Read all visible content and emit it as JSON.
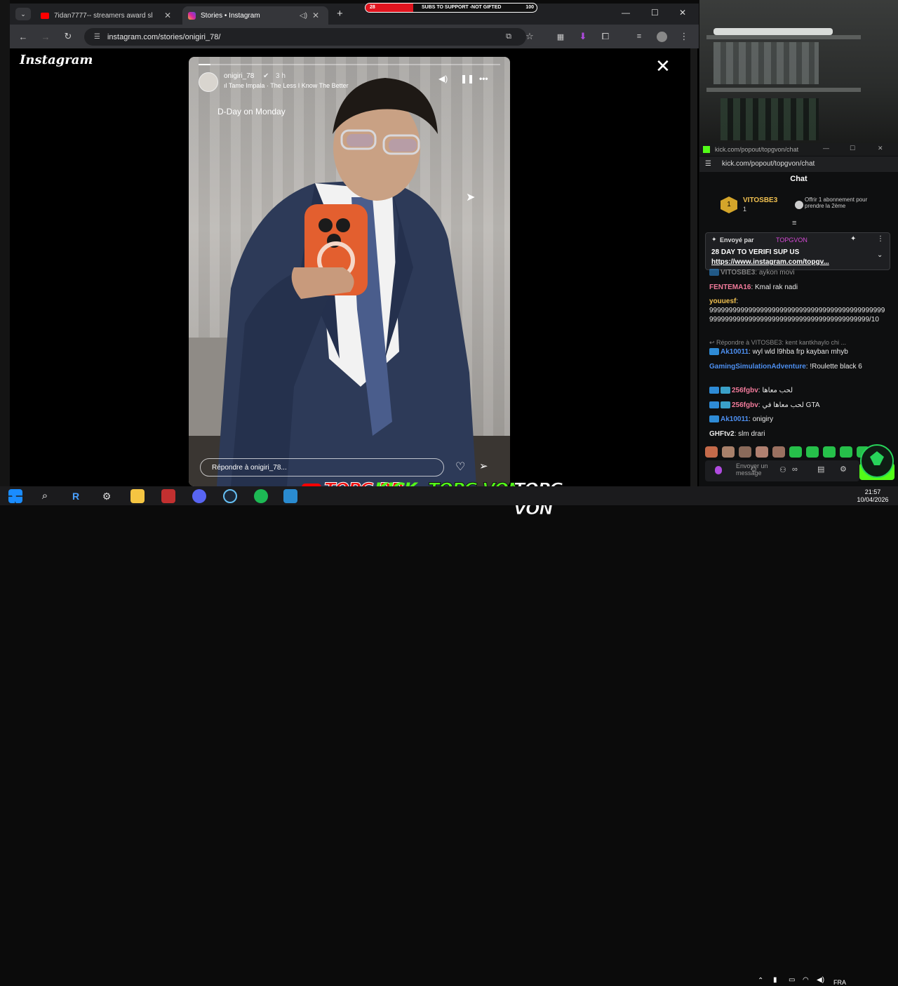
{
  "browser": {
    "tabs": [
      {
        "title": "7idan7777-- streamers award sl"
      },
      {
        "title": "Stories • Instagram"
      }
    ],
    "url": "instagram.com/stories/onigiri_78/"
  },
  "subs_bar": {
    "left": "28",
    "label": "SUBS TO SUPPORT -NOT GIFTED",
    "right": "100",
    "progress": 0.28
  },
  "instagram": {
    "logo": "Instagram",
    "story": {
      "username": "onigiri_78",
      "time": "3 h",
      "music": "Tame Impala · The Less I Know The Better",
      "caption": "D-Day on Monday",
      "reply_placeholder": "Répondre à onigiri_78...",
      "progress": 0.04
    }
  },
  "kick": {
    "window_title": "kick.com/popout/topgvon/chat",
    "url": "kick.com/popout/topgvon/chat",
    "chat_header": "Chat",
    "sub_card": {
      "user": "VITOSBE3",
      "count": "1",
      "offer": "Offrir 1 abonnement pour prendre la 2ème"
    },
    "pinned": {
      "sent_by": "Envoyé par",
      "sender": "TOPGVON",
      "text": "28 DAY TO VERIFI SUP US",
      "link": "https://www.instagram.com/topgv..."
    },
    "messages": [
      {
        "user": "VITOSBE3",
        "text": "aykon movi",
        "color": "#c9c9c9"
      },
      {
        "user": "FENTEMA16",
        "text": "Kmal rak nadi",
        "color": "#f07a9a"
      },
      {
        "user": "youuesf",
        "text": "99999999999999999999999999999999999999999999999999999999999999999999999999999999999999/10",
        "color": "#f0c050"
      },
      {
        "reply": "Répondre à VITOSBE3: kent kantkhaylo chi ..."
      },
      {
        "user": "Ak10011",
        "text": "wyl wld l9hba frp kayban mhyb",
        "color": "#4d8ff0"
      },
      {
        "user": "GamingSimulationAdventure",
        "text": "!Roulette black 6",
        "color": "#4d8ff0"
      },
      {
        "user": "256fgbv",
        "text": "لحب معاها",
        "color": "#f07a9a"
      },
      {
        "user": "256fgbv",
        "text": "لحب معاها في GTA",
        "color": "#f07a9a"
      },
      {
        "user": "Ak10011",
        "text": "onigiry",
        "color": "#4d8ff0"
      },
      {
        "user": "GHFtv2",
        "text": "slm drari",
        "color": "#e8e8e8"
      }
    ],
    "input_placeholder": "Envoyer un message"
  },
  "overlay_banner": {
    "a": "TOPG RP",
    "b": "KICK",
    "c": "TOPG VON",
    "d": "TOPG VON"
  },
  "taskbar": {
    "lang": "FRA",
    "time": "21:57",
    "date": "10/04/2026"
  }
}
